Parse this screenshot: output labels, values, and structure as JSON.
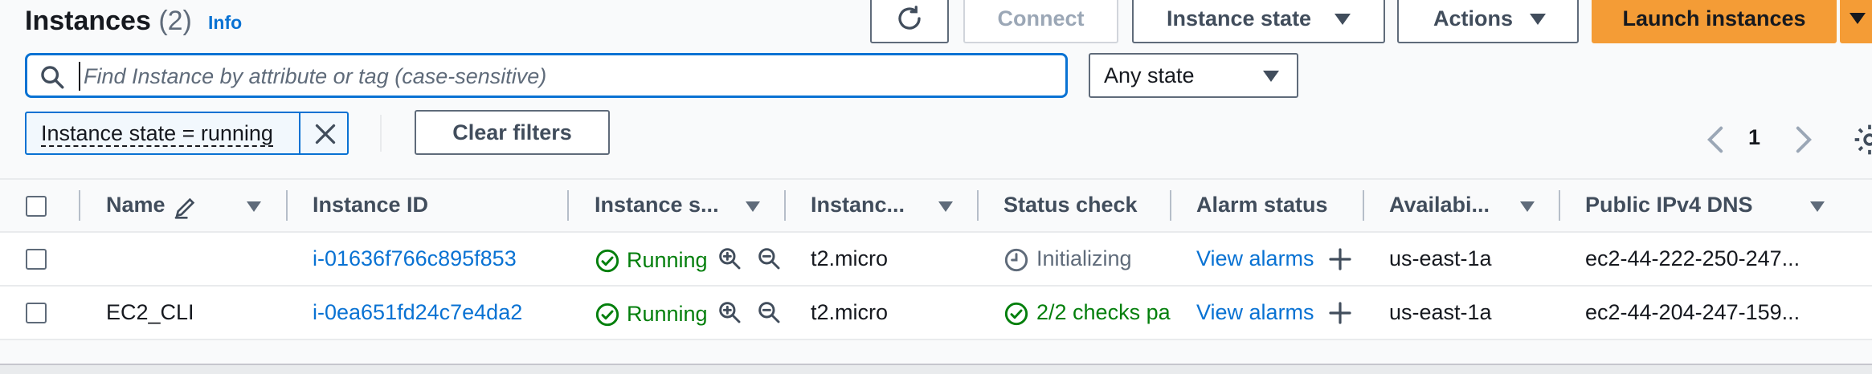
{
  "header": {
    "title": "Instances",
    "count": "(2)",
    "info_link": "Info",
    "connect_label": "Connect",
    "instance_state_label": "Instance state",
    "actions_label": "Actions",
    "launch_label": "Launch instances"
  },
  "search": {
    "placeholder": "Find Instance by attribute or tag (case-sensitive)",
    "state_filter": "Any state"
  },
  "filters": {
    "token_label": "Instance state = running",
    "clear_label": "Clear filters"
  },
  "pagination": {
    "page": "1"
  },
  "table": {
    "columns": [
      "Name",
      "Instance ID",
      "Instance s...",
      "Instanc...",
      "Status check",
      "Alarm status",
      "Availabi...",
      "Public IPv4 DNS"
    ],
    "rows": [
      {
        "name": "",
        "instance_id": "i-01636f766c895f853",
        "state": "Running",
        "type": "t2.micro",
        "status_check": "Initializing",
        "alarm": "View alarms",
        "az": "us-east-1a",
        "dns": "ec2-44-222-250-247..."
      },
      {
        "name": "EC2_CLI",
        "instance_id": "i-0ea651fd24c7e4da2",
        "state": "Running",
        "type": "t2.micro",
        "status_check": "2/2 checks pa",
        "alarm": "View alarms",
        "az": "us-east-1a",
        "dns": "ec2-44-204-247-159..."
      }
    ]
  },
  "colors": {
    "accent": "#0972d3",
    "launch": "#f49c36",
    "success": "#037f0c",
    "text": "#16191f"
  }
}
